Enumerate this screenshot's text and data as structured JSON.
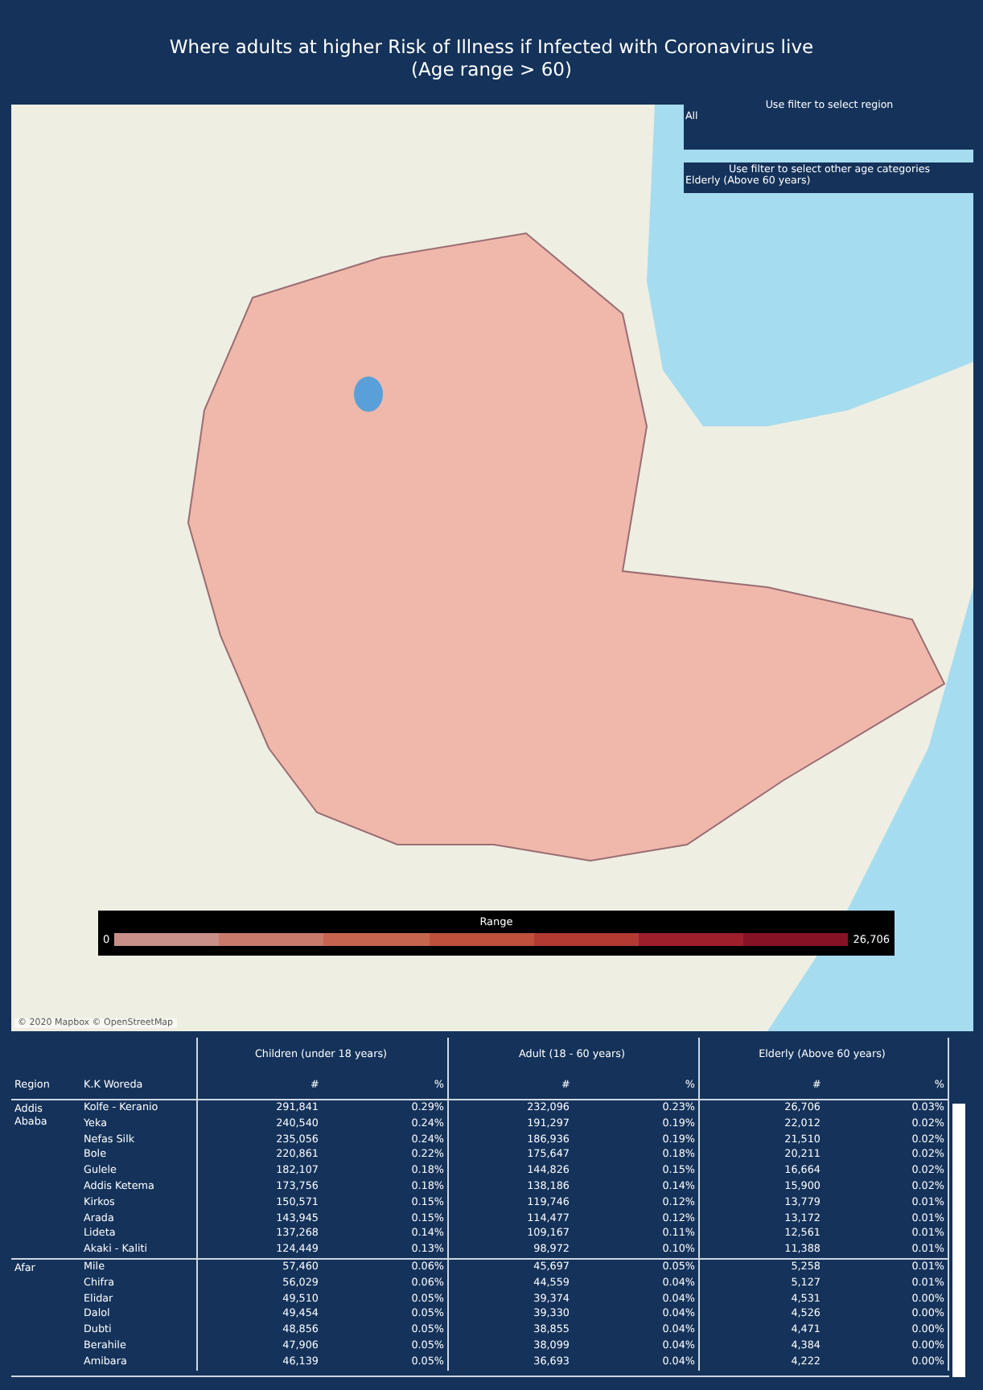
{
  "title": [
    "Where adults at higher Risk of Illness if Infected with Coronavirus live",
    "(Age range > 60)"
  ],
  "filters": [
    {
      "label": "Use filter to select region",
      "value": "All"
    },
    {
      "label": "Use filter to select other age categories",
      "value": "Elderly (Above 60 years)"
    }
  ],
  "map": {
    "attribution": "© 2020 Mapbox © OpenStreetMap",
    "legend": {
      "title": "Range",
      "min": "0",
      "max": "26,706"
    }
  },
  "table": {
    "region_header": "Region",
    "woreda_header": "K.K Woreda",
    "column_groups": [
      {
        "title": "Children (under 18 years)",
        "count_header": "#",
        "share_header": "%"
      },
      {
        "title": "Adult (18 - 60 years)",
        "count_header": "#",
        "share_header": "%"
      },
      {
        "title": "Elderly (Above 60 years)",
        "count_header": "#",
        "share_header": "%"
      }
    ],
    "groups": [
      {
        "region": "Addis Ababa",
        "rows": [
          [
            "Kolfe - Keranio",
            "291,841",
            "0.29%",
            "232,096",
            "0.23%",
            "26,706",
            "0.03%"
          ],
          [
            "Yeka",
            "240,540",
            "0.24%",
            "191,297",
            "0.19%",
            "22,012",
            "0.02%"
          ],
          [
            "Nefas Silk",
            "235,056",
            "0.24%",
            "186,936",
            "0.19%",
            "21,510",
            "0.02%"
          ],
          [
            "Bole",
            "220,861",
            "0.22%",
            "175,647",
            "0.18%",
            "20,211",
            "0.02%"
          ],
          [
            "Gulele",
            "182,107",
            "0.18%",
            "144,826",
            "0.15%",
            "16,664",
            "0.02%"
          ],
          [
            "Addis Ketema",
            "173,756",
            "0.18%",
            "138,186",
            "0.14%",
            "15,900",
            "0.02%"
          ],
          [
            "Kirkos",
            "150,571",
            "0.15%",
            "119,746",
            "0.12%",
            "13,779",
            "0.01%"
          ],
          [
            "Arada",
            "143,945",
            "0.15%",
            "114,477",
            "0.12%",
            "13,172",
            "0.01%"
          ],
          [
            "Lideta",
            "137,268",
            "0.14%",
            "109,167",
            "0.11%",
            "12,561",
            "0.01%"
          ],
          [
            "Akaki - Kaliti",
            "124,449",
            "0.13%",
            "98,972",
            "0.10%",
            "11,388",
            "0.01%"
          ]
        ]
      },
      {
        "region": "Afar",
        "rows": [
          [
            "Mile",
            "57,460",
            "0.06%",
            "45,697",
            "0.05%",
            "5,258",
            "0.01%"
          ],
          [
            "Chifra",
            "56,029",
            "0.06%",
            "44,559",
            "0.04%",
            "5,127",
            "0.01%"
          ],
          [
            "Elidar",
            "49,510",
            "0.05%",
            "39,374",
            "0.04%",
            "4,531",
            "0.00%"
          ],
          [
            "Dalol",
            "49,454",
            "0.05%",
            "39,330",
            "0.04%",
            "4,526",
            "0.00%"
          ],
          [
            "Dubti",
            "48,856",
            "0.05%",
            "38,855",
            "0.04%",
            "4,471",
            "0.00%"
          ],
          [
            "Berahile",
            "47,906",
            "0.05%",
            "38,099",
            "0.04%",
            "4,384",
            "0.00%"
          ],
          [
            "Amibara",
            "46,139",
            "0.05%",
            "36,693",
            "0.04%",
            "4,222",
            "0.00%"
          ]
        ]
      }
    ]
  }
}
